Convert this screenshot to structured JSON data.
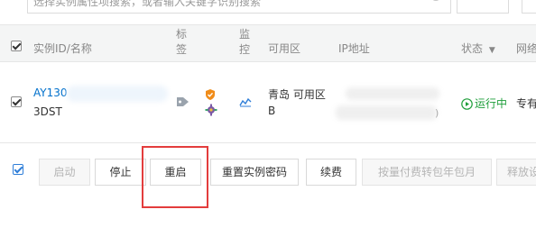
{
  "search": {
    "placeholder_visible": "选择实例属性项搜索，或者输入关键字识别搜索"
  },
  "table": {
    "headers": {
      "instance": "实例ID/名称",
      "tags": "标签",
      "monitor": "监控",
      "zone": "可用区",
      "ip": "IP地址",
      "status": "状态",
      "network": "网络"
    },
    "row": {
      "instance_id": "AY130",
      "instance_name": "3DST",
      "zone": "青岛 可用区B",
      "ip_tail": ")",
      "status": "运行中",
      "network": "专有"
    }
  },
  "actions": {
    "start": "启动",
    "stop": "停止",
    "restart": "重启",
    "reset_password": "重置实例密码",
    "renew": "续费",
    "to_subscription": "按量付费转包年包月",
    "release": "释放设"
  },
  "colors": {
    "link": "#0070cc",
    "status_running": "#1e9e3a",
    "highlight": "#e33d3d",
    "header_bg": "#f4f5f5"
  }
}
